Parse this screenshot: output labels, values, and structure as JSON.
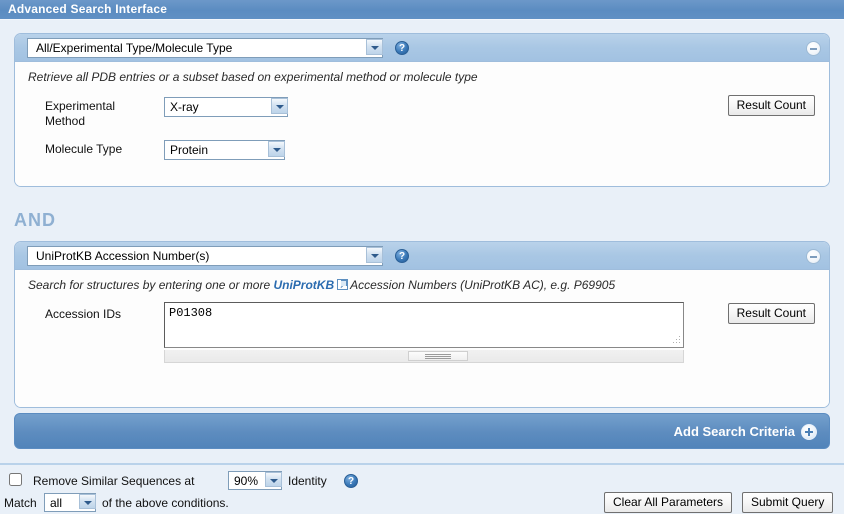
{
  "titlebar": {
    "title": "Advanced Search Interface"
  },
  "panels": [
    {
      "id": "panel-experimental",
      "selected_criteria": "All/Experimental Type/Molecule Type",
      "help_icon": "question-mark-icon",
      "collapse_icon": "minus-icon",
      "description": "Retrieve all PDB entries or a subset based on experimental method or molecule type",
      "fields": [
        {
          "label": "Experimental Method",
          "value": "X-ray"
        },
        {
          "label": "Molecule Type",
          "value": "Protein"
        }
      ],
      "result_count_label": "Result Count"
    },
    {
      "id": "panel-uniprot",
      "selected_criteria": "UniProtKB Accession Number(s)",
      "help_icon": "question-mark-icon",
      "collapse_icon": "minus-icon",
      "description_pre": "Search for structures by entering one or more ",
      "description_link": "UniProtKB",
      "description_link_icon": "external-link-icon",
      "description_post": "Accession Numbers (UniProtKB AC), e.g. P69905",
      "field_label": "Accession IDs",
      "textarea_value": "P01308",
      "result_count_label": "Result Count"
    }
  ],
  "operator": "AND",
  "add_bar": {
    "label": "Add Search Criteria",
    "icon": "plus-circle-icon"
  },
  "footer": {
    "remove_similar_checked": false,
    "remove_similar_pre": "Remove Similar Sequences at",
    "identity_value": "90%",
    "remove_similar_post": "Identity",
    "identity_help_icon": "question-mark-icon",
    "match_pre": "Match",
    "match_value": "all",
    "match_post": "of the above conditions.",
    "clear_label": "Clear All Parameters",
    "submit_label": "Submit Query"
  },
  "colors": {
    "titlebar": "#5b8cc1",
    "panel_header": "#a9c7e4",
    "page_background": "#e9f0f8",
    "accent_link": "#2b6cb0",
    "operator_text": "#8fb0d2"
  }
}
